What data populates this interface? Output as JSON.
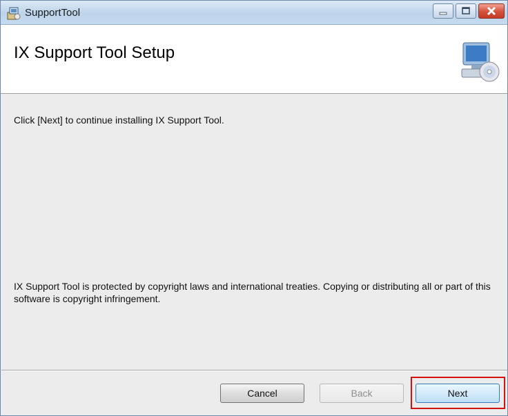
{
  "window": {
    "title": "SupportTool"
  },
  "header": {
    "title": "IX Support Tool Setup"
  },
  "body": {
    "instruction": "Click [Next] to continue installing  IX Support Tool.",
    "copyright": "IX Support Tool is protected by copyright laws and international treaties. Copying or distributing all or part of this software is copyright infringement."
  },
  "buttons": {
    "cancel": "Cancel",
    "back": "Back",
    "next": "Next"
  },
  "colors": {
    "highlight": "#d41111",
    "close_button": "#c33a25"
  },
  "icons": [
    "installer-icon",
    "minimize-icon",
    "maximize-icon",
    "close-icon",
    "computer-disc-icon"
  ]
}
